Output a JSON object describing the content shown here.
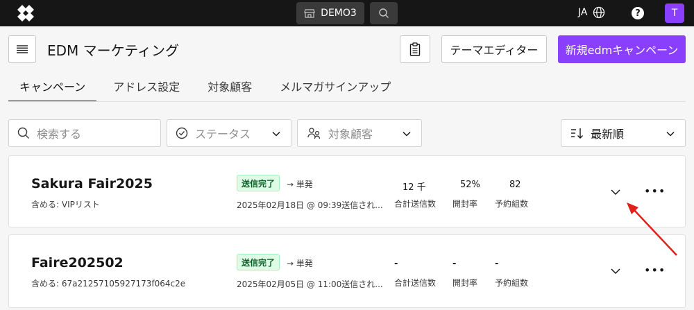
{
  "topbar": {
    "store": "DEMO3",
    "lang": "JA",
    "help": "?",
    "avatar": "T",
    "icons": [
      "logo-icon",
      "store-icon",
      "search-icon",
      "globe-icon",
      "help-icon"
    ]
  },
  "header": {
    "title": "EDM マーケティング",
    "theme_editor": "テーマエディター",
    "new_campaign": "新規edmキャンペーン"
  },
  "tabs": [
    "キャンペーン",
    "アドレス設定",
    "対象顧客",
    "メルマガサインアップ"
  ],
  "filters": {
    "search_placeholder": "検索する",
    "status": "ステータス",
    "target": "対象顧客",
    "sort": "最新順"
  },
  "campaigns": [
    {
      "name": "Sakura Fair2025",
      "includes": "含める: VIPリスト",
      "status": "送信完了",
      "type": "→ 単発",
      "sent_at": "2025年02月18日 @ 09:39送信され...",
      "total_sent": "12 千",
      "open_rate": "52%",
      "bookings": "82"
    },
    {
      "name": "Faire202502",
      "includes": "含める: 67a21257105927173f064c2e",
      "status": "送信完了",
      "type": "→ 単発",
      "sent_at": "2025年02月05日 @ 11:00送信され...",
      "total_sent": "-",
      "open_rate": "-",
      "bookings": "-"
    }
  ],
  "metric_labels": {
    "total_sent": "合計送信数",
    "open_rate": "開封率",
    "bookings": "予約組数"
  },
  "colors": {
    "topbar": "#161616",
    "accent": "#8a3ffc",
    "success_bg": "#defbe6",
    "success_text": "#0e6027",
    "annotation": "#e0201b"
  }
}
